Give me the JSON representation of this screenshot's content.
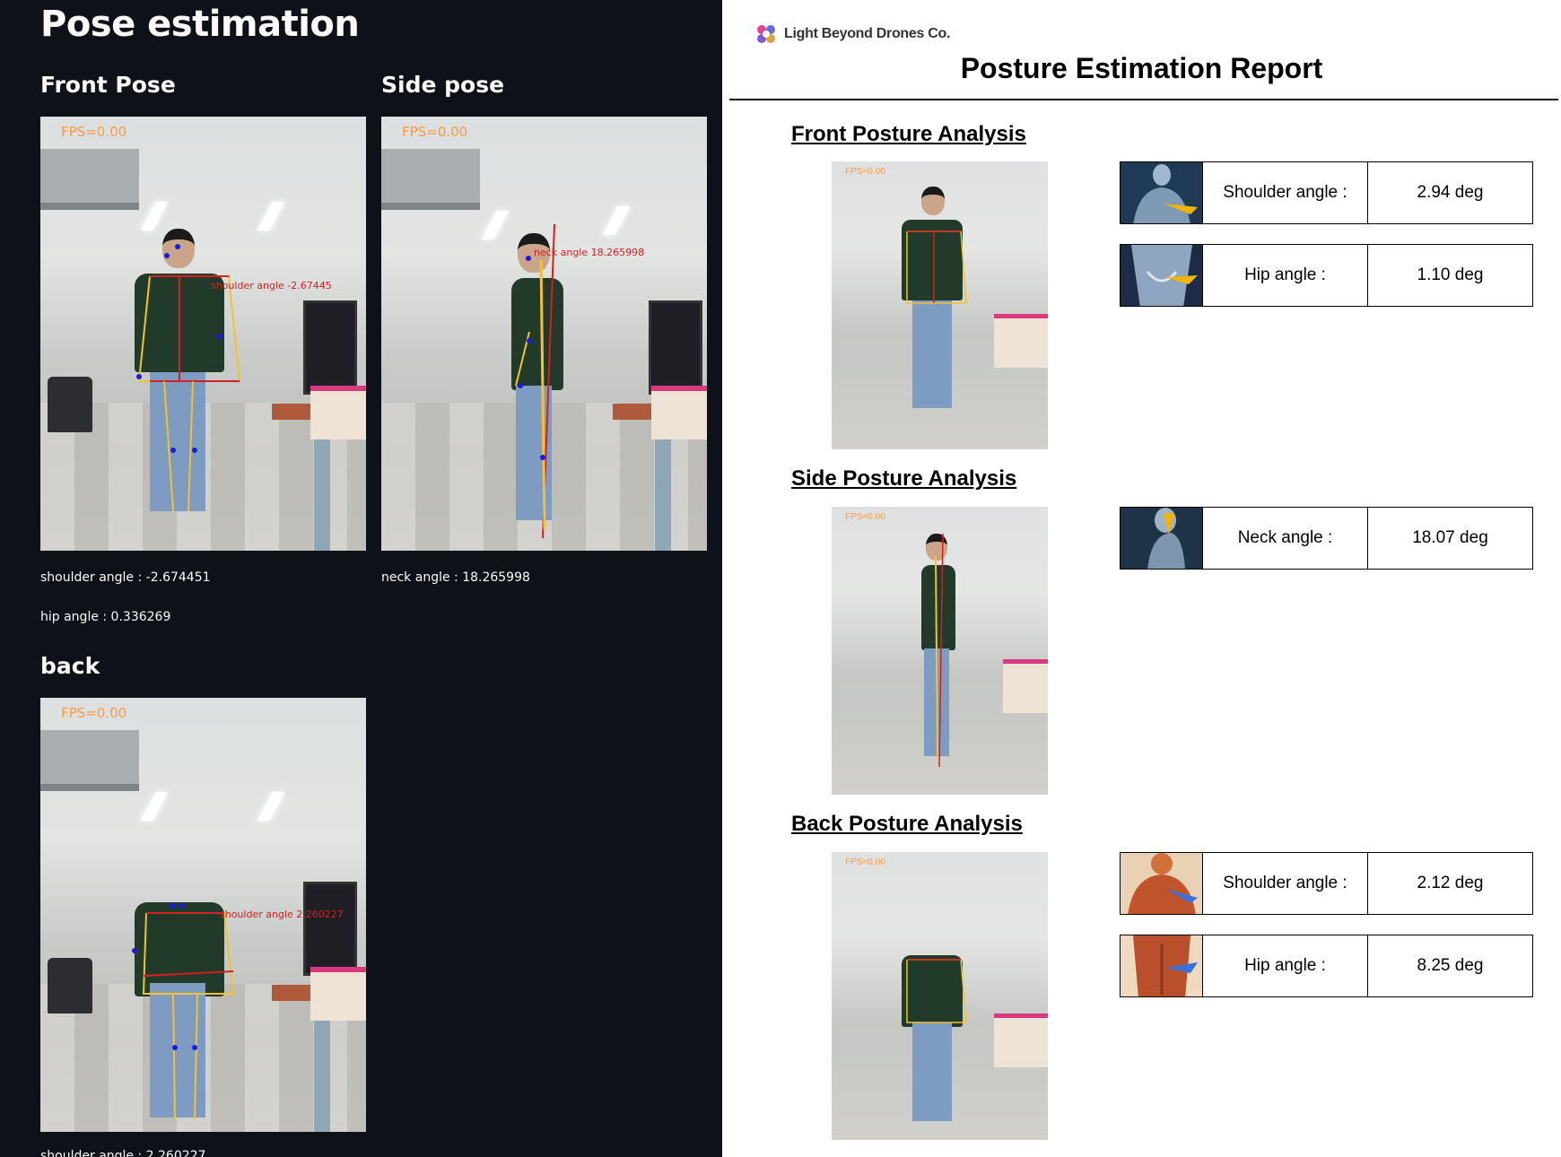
{
  "app": {
    "title": "Pose estimation",
    "front": {
      "heading": "Front Pose",
      "fps": "FPS=0.00",
      "overlay": "shoulder angle -2.67445",
      "metric1": "shoulder angle : -2.674451",
      "metric2": "hip angle : 0.336269"
    },
    "side": {
      "heading": "Side pose",
      "fps": "FPS=0.00",
      "overlay": "neck angle 18.265998",
      "metric1": "neck angle : 18.265998"
    },
    "back": {
      "heading": "back",
      "fps": "FPS=0.00",
      "overlay": "shoulder angle 2.260227",
      "metric1": "shoulder angle : 2.260227"
    }
  },
  "report": {
    "company": "Light Beyond Drones Co.",
    "title": "Posture Estimation Report",
    "sections": [
      {
        "heading": "Front Posture Analysis",
        "fps": "FPS=0.00",
        "rows": [
          {
            "label": "Shoulder angle :",
            "value": "2.94 deg",
            "icon": "shoulder-anatomy-icon"
          },
          {
            "label": "Hip angle :",
            "value": "1.10 deg",
            "icon": "hip-anatomy-icon"
          }
        ]
      },
      {
        "heading": "Side Posture Analysis",
        "fps": "FPS=0.00",
        "rows": [
          {
            "label": "Neck angle :",
            "value": "18.07 deg",
            "icon": "neck-anatomy-icon"
          }
        ]
      },
      {
        "heading": "Back Posture Analysis",
        "fps": "FPS=0.00",
        "rows": [
          {
            "label": "Shoulder angle :",
            "value": "2.12 deg",
            "icon": "back-shoulder-anatomy-icon"
          },
          {
            "label": "Hip angle :",
            "value": "8.25 deg",
            "icon": "back-hip-anatomy-icon"
          }
        ]
      }
    ]
  },
  "colors": {
    "dark_bg": "#0e1117",
    "skeleton_yellow": "#f2c230",
    "skeleton_red": "#d42020",
    "keypoint_blue": "#1a1ae6",
    "fps_orange": "#ff9a3c"
  }
}
